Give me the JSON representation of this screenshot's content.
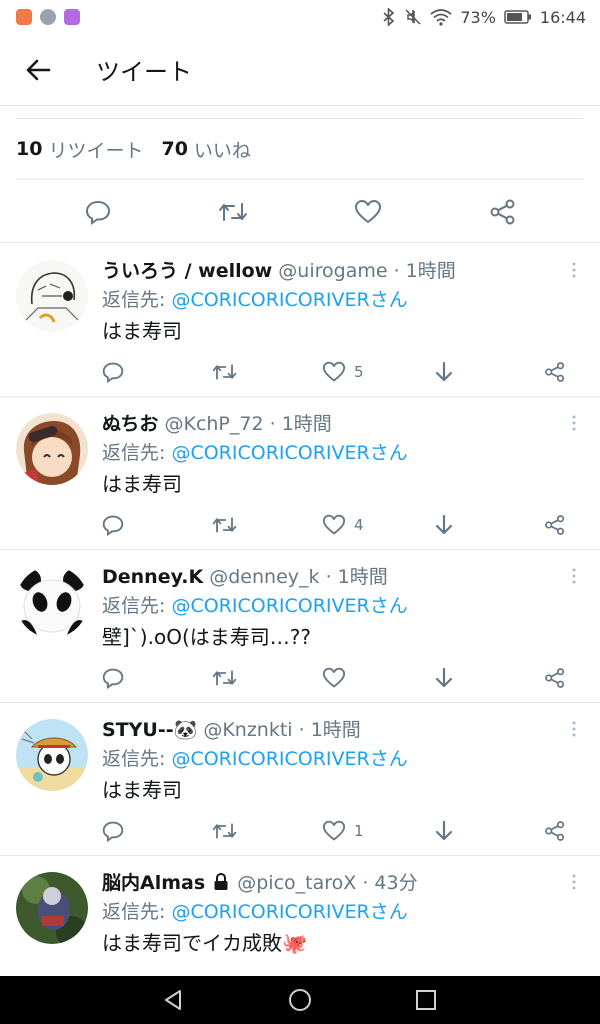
{
  "status_bar": {
    "battery": "73%",
    "time": "16:44"
  },
  "header": {
    "title": "ツイート"
  },
  "stats": {
    "retweets_count": "10",
    "retweets_label": "リツイート",
    "likes_count": "70",
    "likes_label": "いいね"
  },
  "replies": [
    {
      "name": "ういろう / wellow",
      "handle": "@uirogame",
      "time": "· 1時間",
      "reply_prefix": "返信先:",
      "reply_mention": "@CORICORICORIVERさん",
      "text": "はま寿司",
      "likes": "5"
    },
    {
      "name": "ぬちお",
      "handle": "@KchP_72",
      "time": "· 1時間",
      "reply_prefix": "返信先:",
      "reply_mention": "@CORICORICORIVERさん",
      "text": "はま寿司",
      "likes": "4"
    },
    {
      "name": "Denney.K",
      "handle": "@denney_k",
      "time": "· 1時間",
      "reply_prefix": "返信先:",
      "reply_mention": "@CORICORICORIVERさん",
      "text": "壁]`).oO(はま寿司…??",
      "likes": ""
    },
    {
      "name": "STYU--🐼",
      "handle": "@Knznkti",
      "time": "· 1時間",
      "reply_prefix": "返信先:",
      "reply_mention": "@CORICORICORIVERさん",
      "text": "はま寿司",
      "likes": "1"
    },
    {
      "name": "脳内Almas",
      "handle": "@pico_taroX",
      "time": "· 43分",
      "reply_prefix": "返信先:",
      "reply_mention": "@CORICORICORIVERさん",
      "text": "はま寿司でイカ成敗🐙",
      "likes": ""
    }
  ],
  "colors": {
    "accent": "#1da1f2",
    "secondary_text": "#657786",
    "divider": "#e1e8ed"
  }
}
